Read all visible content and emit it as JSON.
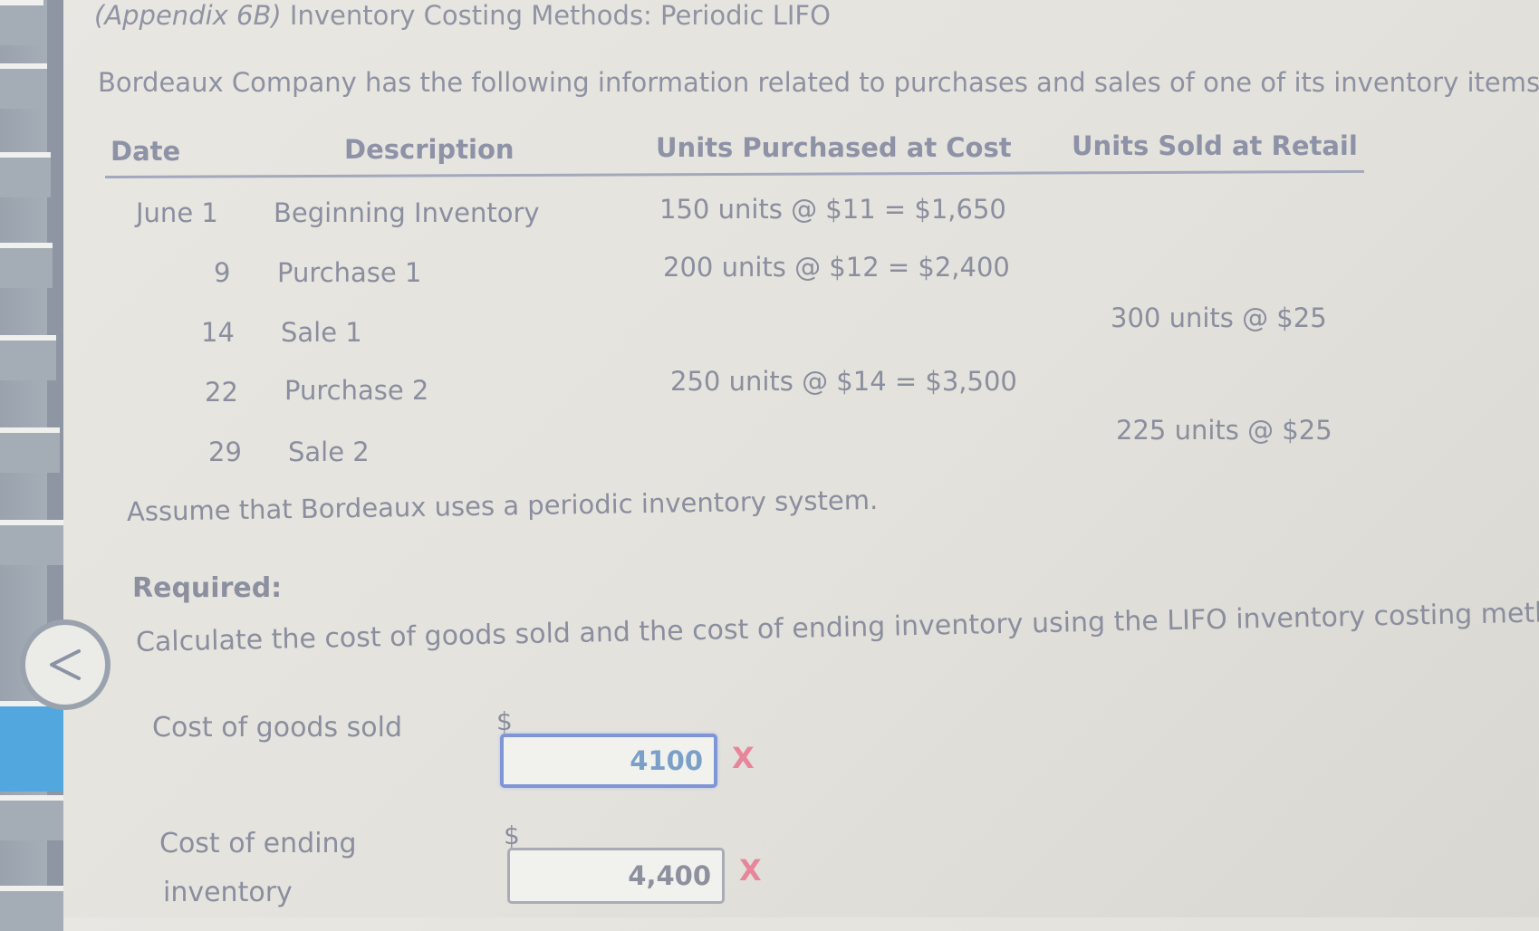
{
  "page": {
    "title_prefix": "(Appendix 6B)",
    "title_main": " Inventory Costing Methods: Periodic LIFO",
    "intro": "Bordeaux Company has the following information related to purchases and sales of one of its inventory items:"
  },
  "sidebar": {
    "nav_items": [
      {
        "state": "default"
      },
      {
        "state": "default"
      },
      {
        "state": "default"
      },
      {
        "state": "default"
      },
      {
        "state": "default"
      },
      {
        "state": "default"
      },
      {
        "state": "default"
      },
      {
        "state": "active"
      },
      {
        "state": "default"
      },
      {
        "state": "default"
      }
    ],
    "back_icon": "chevron-left-icon",
    "active_color": "#52a7df"
  },
  "table": {
    "headers": {
      "date": "Date",
      "description": "Description",
      "purchased": "Units Purchased at Cost",
      "sold": "Units Sold at Retail"
    },
    "rows": [
      {
        "date": "June 1",
        "description": "Beginning Inventory",
        "purchased": "150 units @ $11 = $1,650",
        "sold": ""
      },
      {
        "date": "9",
        "description": "Purchase 1",
        "purchased": "200 units @ $12 = $2,400",
        "sold": ""
      },
      {
        "date": "14",
        "description": "Sale 1",
        "purchased": "",
        "sold": "300 units @ $25"
      },
      {
        "date": "22",
        "description": "Purchase 2",
        "purchased": "250 units @ $14 = $3,500",
        "sold": ""
      },
      {
        "date": "29",
        "description": "Sale 2",
        "purchased": "",
        "sold": "225 units @ $25"
      }
    ]
  },
  "assumption": "Assume that Bordeaux uses a periodic inventory system.",
  "required": {
    "heading": "Required:",
    "instruction": "Calculate the cost of goods sold and the cost of ending inventory using the LIFO inventory costing method."
  },
  "answers": {
    "cogs": {
      "label": "Cost of goods sold",
      "currency": "$",
      "value": "4100",
      "status": "incorrect",
      "status_icon": "X"
    },
    "ending_inventory": {
      "label_line1": "Cost of ending",
      "label_line2": "inventory",
      "currency": "$",
      "value": "4,400",
      "status": "incorrect",
      "status_icon": "X"
    }
  },
  "colors": {
    "incorrect": "#e7869a",
    "focus_border": "#7f95d6"
  }
}
